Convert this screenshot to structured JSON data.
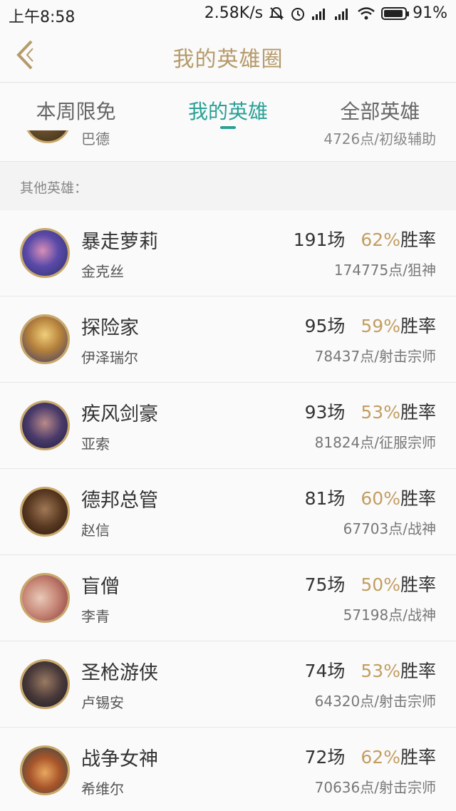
{
  "status": {
    "time": "上午8:58",
    "speed": "2.58K/s",
    "battery": "91%",
    "icons": [
      "mute-icon",
      "alarm-icon",
      "signal-icon",
      "signal-icon",
      "wifi-icon",
      "battery-icon"
    ]
  },
  "header": {
    "title": "我的英雄圈",
    "accent": "#b59a6a"
  },
  "tabs": [
    {
      "label": "本周限免",
      "active": false
    },
    {
      "label": "我的英雄",
      "active": true
    },
    {
      "label": "全部英雄",
      "active": false
    }
  ],
  "partial_row": {
    "real_name": "巴德",
    "points": "4726点/初级辅助"
  },
  "section_label": "其他英雄：",
  "heroes": [
    {
      "title": "暴走萝莉",
      "name": "金克丝",
      "games": "191场",
      "rate": "62%",
      "rate_suffix": "胜率",
      "points": "174775点/狙神"
    },
    {
      "title": "探险家",
      "name": "伊泽瑞尔",
      "games": "95场",
      "rate": "59%",
      "rate_suffix": "胜率",
      "points": "78437点/射击宗师"
    },
    {
      "title": "疾风剑豪",
      "name": "亚索",
      "games": "93场",
      "rate": "53%",
      "rate_suffix": "胜率",
      "points": "81824点/征服宗师"
    },
    {
      "title": "德邦总管",
      "name": "赵信",
      "games": "81场",
      "rate": "60%",
      "rate_suffix": "胜率",
      "points": "67703点/战神"
    },
    {
      "title": "盲僧",
      "name": "李青",
      "games": "75场",
      "rate": "50%",
      "rate_suffix": "胜率",
      "points": "57198点/战神"
    },
    {
      "title": "圣枪游侠",
      "name": "卢锡安",
      "games": "74场",
      "rate": "53%",
      "rate_suffix": "胜率",
      "points": "64320点/射击宗师"
    },
    {
      "title": "战争女神",
      "name": "希维尔",
      "games": "72场",
      "rate": "62%",
      "rate_suffix": "胜率",
      "points": "70636点/射击宗师"
    }
  ],
  "colors": {
    "active_tab": "#2aa095",
    "win_rate": "#c29e62"
  }
}
